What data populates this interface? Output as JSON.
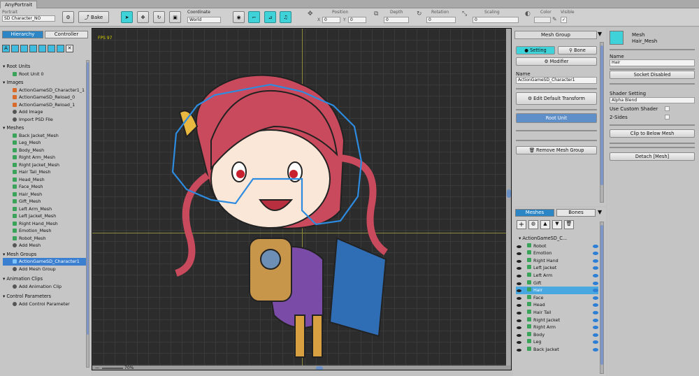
{
  "window": {
    "title": "AnyPortrait"
  },
  "toolbar": {
    "portrait_label": "Portrait",
    "portrait_value": "SD Character_NO",
    "bake": "Bake",
    "coordinate_label": "Coordinate",
    "coordinate_value": "World",
    "position": "Position",
    "x": "X",
    "x_val": "0",
    "y": "Y",
    "y_val": "0",
    "depth": "Depth",
    "depth_val": "0",
    "rotation": "Rotation",
    "rotation_val": "0",
    "scaling": "Scaling",
    "scaling_val": "0",
    "color": "Color",
    "visible": "Visible"
  },
  "hierarchy": {
    "tab1": "Hierarchy",
    "tab2": "Controller",
    "sections": [
      {
        "title": "Root Units",
        "items": [
          "Root Unit 0"
        ]
      },
      {
        "title": "Images",
        "items": [
          "ActionGameSD_Character1_1",
          "ActionGameSD_Reload_0",
          "ActionGameSD_Reload_1",
          "Add Image",
          "Import PSD File"
        ]
      },
      {
        "title": "Meshes",
        "items": [
          "Back Jacket_Mesh",
          "Leg_Mesh",
          "Body_Mesh",
          "Right Arm_Mesh",
          "Right Jacket_Mesh",
          "Hair Tail_Mesh",
          "Head_Mesh",
          "Face_Mesh",
          "Hair_Mesh",
          "Gift_Mesh",
          "Left Arm_Mesh",
          "Left Jacket_Mesh",
          "Right Hand_Mesh",
          "Emotion_Mesh",
          "Robot_Mesh",
          "Add Mesh"
        ]
      },
      {
        "title": "Mesh Groups",
        "items": [
          "ActionGameSD_Character1",
          "Add Mesh Group"
        ]
      },
      {
        "title": "Animation Clips",
        "items": [
          "Add Animation Clip"
        ]
      },
      {
        "title": "Control Parameters",
        "items": [
          "Add Control Parameter"
        ]
      }
    ]
  },
  "viewport": {
    "fps": "FPS 97",
    "zoom": "70%"
  },
  "meshgroup": {
    "header": "Mesh Group",
    "setting": "Setting",
    "bone": "Bone",
    "modifier": "Modifier",
    "name_label": "Name",
    "name_value": "ActionGameSD_Character1",
    "edit_transform": "Edit Default Transform",
    "root_unit": "Root Unit",
    "remove": "Remove Mesh Group"
  },
  "meshes": {
    "tab1": "Meshes",
    "tab2": "Bones",
    "root": "ActionGameSD_C...",
    "items": [
      "Robot",
      "Emotion",
      "Right Hand",
      "Left Jacket",
      "Left Arm",
      "Gift",
      "Hair",
      "Face",
      "Head",
      "Hair Tail",
      "Right Jacket",
      "Right Arm",
      "Body",
      "Leg",
      "Back Jacket"
    ],
    "selected": "Hair"
  },
  "inspector": {
    "type": "Mesh",
    "mesh_name": "Hair_Mesh",
    "name_label": "Name",
    "name_value": "Hair",
    "socket": "Socket Disabled",
    "shader_label": "Shader Setting",
    "shader_value": "Alpha Blend",
    "custom_shader": "Use Custom Shader",
    "two_sides": "2-Sides",
    "clip": "Clip to Below Mesh",
    "detach": "Detach [Mesh]"
  },
  "colors": {
    "accent": "#3fd2d8",
    "select": "#3a7fd0",
    "mesh_outline": "#2d8be0"
  }
}
